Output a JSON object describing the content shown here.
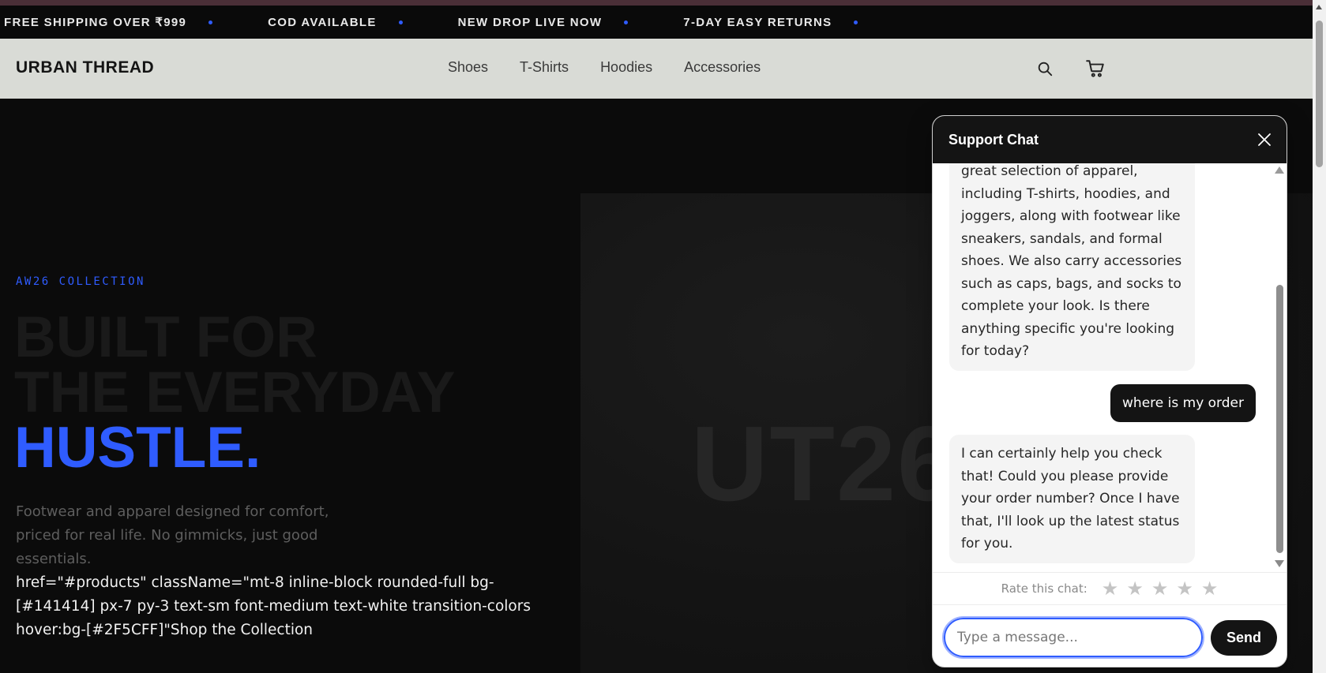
{
  "ticker": {
    "items": [
      "FREE SHIPPING OVER ₹999",
      "COD AVAILABLE",
      "NEW DROP LIVE NOW",
      "7-DAY EASY RETURNS"
    ]
  },
  "header": {
    "logo": "URBAN THREAD",
    "nav": [
      "Shoes",
      "T-Shirts",
      "Hoodies",
      "Accessories"
    ],
    "search_icon": "search-icon",
    "cart_icon": "cart-icon"
  },
  "hero": {
    "eyebrow": "AW26 COLLECTION",
    "headline_line1": "BUILT FOR",
    "headline_line2": "THE EVERYDAY",
    "headline_accent": "HUSTLE.",
    "description": "Footwear and apparel designed for comfort, priced for real life. No gimmicks, just good essentials.",
    "raw_link_text": "href=\"#products\" className=\"mt-8 inline-block rounded-full bg-[#141414] px-7 py-3 text-sm font-medium text-white transition-colors hover:bg-[#2F5CFF]\"Shop the Collection",
    "watermark": "UT26"
  },
  "chat": {
    "title": "Support Chat",
    "close_icon": "close-icon",
    "messages": [
      {
        "role": "bot",
        "text": "great selection of apparel, including T-shirts, hoodies, and joggers, along with footwear like sneakers, sandals, and formal shoes. We also carry accessories such as caps, bags, and socks to complete your look. Is there anything specific you're looking for today?"
      },
      {
        "role": "user",
        "text": "where is my order"
      },
      {
        "role": "bot",
        "text": "I can certainly help you check that! Could you please provide your order number? Once I have that, I'll look up the latest status for you."
      }
    ],
    "rate_label": "Rate this chat:",
    "star_glyph": "★",
    "input_placeholder": "Type a message...",
    "send_label": "Send"
  },
  "colors": {
    "accent": "#2F5CFF",
    "dark": "#141414",
    "nav_bg": "#D9DBD6"
  }
}
